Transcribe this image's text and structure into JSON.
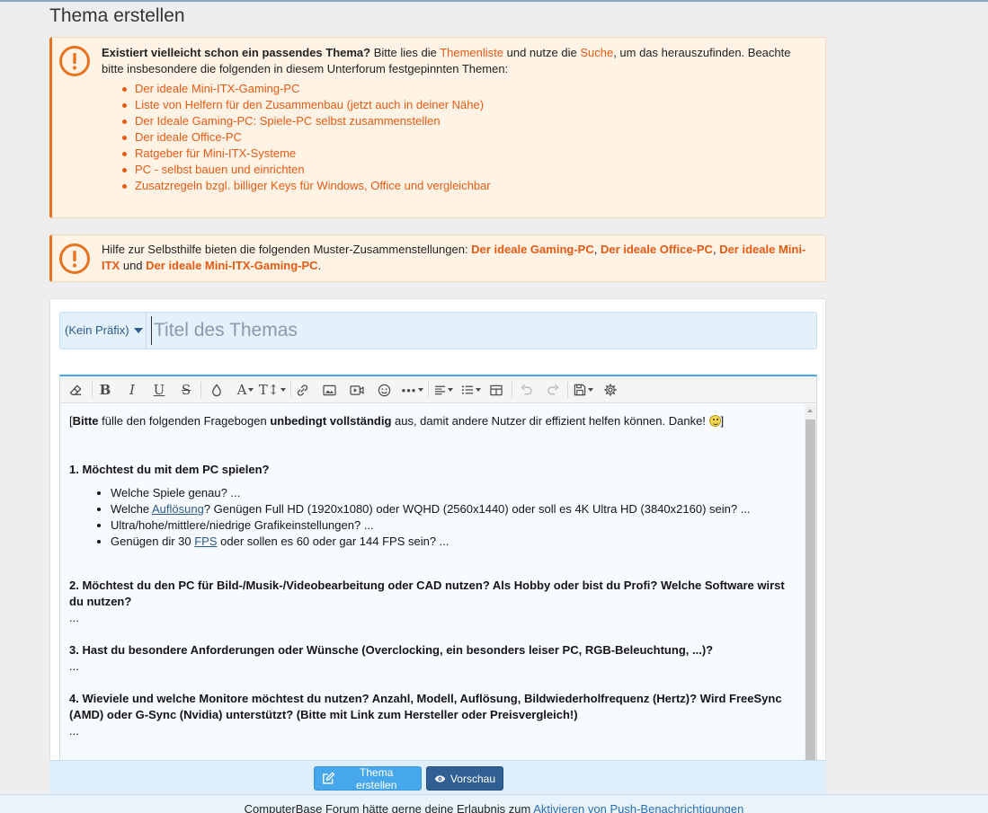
{
  "page": {
    "title": "Thema erstellen"
  },
  "notice1": {
    "strong": "Existiert vielleicht schon ein passendes Thema?",
    "text_a": " Bitte lies die ",
    "link_list": "Themenliste",
    "text_b": " und nutze die ",
    "link_search": "Suche",
    "text_c": ", um das herauszufinden. Beachte bitte insbesondere die folgenden in diesem Unterforum festgepinnten Themen:",
    "items": [
      "Der ideale Mini-ITX-Gaming-PC",
      "Liste von Helfern für den Zusammenbau (jetzt auch in deiner Nähe)",
      "Der Ideale Gaming-PC: Spiele-PC selbst zusammenstellen",
      "Der ideale Office-PC",
      "Ratgeber für Mini-ITX-Systeme",
      "PC - selbst bauen und einrichten",
      "Zusatzregeln bzgl. billiger Keys für Windows, Office und vergleichbar"
    ]
  },
  "notice2": {
    "text_a": "Hilfe zur Selbsthilfe bieten die folgenden Muster-Zusammenstellungen: ",
    "link1": "Der ideale Gaming-PC",
    "sep1": ", ",
    "link2": "Der ideale Office-PC",
    "sep2": ", ",
    "link3": "Der ideale Mini-ITX",
    "and": " und ",
    "link4": "Der ideale Mini-ITX-Gaming-PC",
    "end": "."
  },
  "form": {
    "prefix": "(Kein Präfix)",
    "title_placeholder": "Titel des Themas"
  },
  "editor": {
    "intro_open": "[",
    "intro_b1": "Bitte",
    "intro_t1": " fülle den folgenden Fragebogen ",
    "intro_b2": "unbedingt vollständig",
    "intro_t2": " aus, damit andere Nutzer dir effizient helfen können. Danke! ",
    "intro_close": "]",
    "q1": "1. Möchtest du mit dem PC spielen?",
    "q1_items": {
      "i1": "Welche Spiele genau? ...",
      "i2_a": "Welche ",
      "i2_link": "Auflösung",
      "i2_b": "? Genügen Full HD (1920x1080) oder WQHD (2560x1440) oder soll es 4K Ultra HD (3840x2160) sein? ...",
      "i3": "Ultra/hohe/mittlere/niedrige Grafikeinstellungen? ...",
      "i4_a": "Genügen dir 30 ",
      "i4_link": "FPS",
      "i4_b": " oder sollen es 60 oder gar 144 FPS sein? ..."
    },
    "q2": "2. Möchtest du den PC für Bild-/Musik-/Videobearbeitung oder CAD nutzen? Als Hobby oder bist du Profi? Welche Software wirst du nutzen?",
    "q3": "3. Hast du besondere Anforderungen oder Wünsche (Overclocking, ein besonders leiser PC, RGB-Beleuchtung, ...)?",
    "q4": "4. Wieviele und welche Monitore möchtest du nutzen? Anzahl, Modell, Auflösung, Bildwiederholfrequenz (Hertz)? Wird FreeSync (AMD) oder G-Sync (Nvidia) unterstützt? (Bitte mit Link zum Hersteller oder Preisvergleich!)",
    "ellipsis": "..."
  },
  "buttons": {
    "create": "Thema erstellen",
    "preview": "Vorschau"
  },
  "push": {
    "text": "ComputerBase Forum hätte gerne deine Erlaubnis zum ",
    "link": "Aktivieren von Push-Benachrichtigungen"
  },
  "colors": {
    "accent_orange": "#e55b13",
    "notice_bg": "#fff3e6",
    "primary_blue": "#47a7eb",
    "dark_blue": "#2f5f93"
  }
}
